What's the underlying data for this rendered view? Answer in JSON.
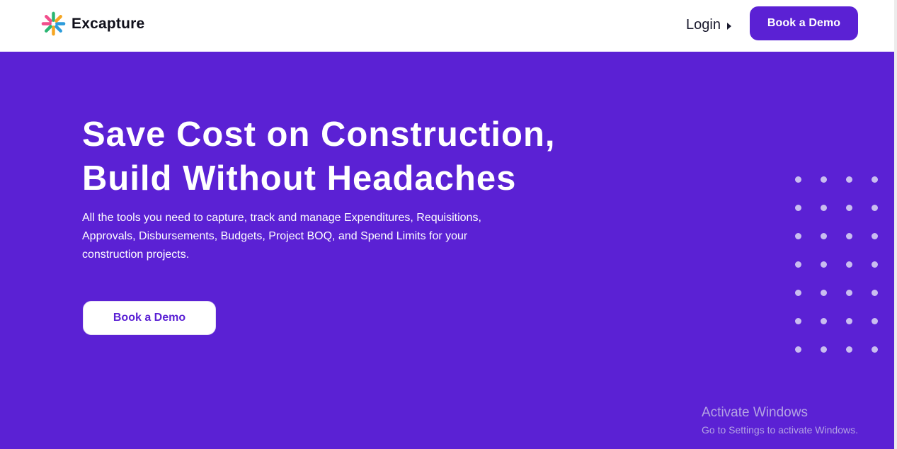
{
  "brand": {
    "name": "Excapture",
    "logo_colors": [
      "#f24e8c",
      "#f6a623",
      "#2bb673",
      "#2d9cdb"
    ]
  },
  "nav": {
    "login_label": "Login",
    "cta_label": "Book a Demo"
  },
  "hero": {
    "headline_line1": "Save Cost on Construction,",
    "headline_line2": "Build Without Headaches",
    "subtext": "All the tools you need to capture, track and manage Expenditures, Requisitions, Approvals, Disbursements, Budgets, Project BOQ, and Spend Limits for your construction projects.",
    "cta_label": "Book a Demo"
  },
  "decoration": {
    "dot_rows": 7,
    "dot_cols": 4
  },
  "os_watermark": {
    "title": "Activate Windows",
    "subtitle": "Go to Settings to activate Windows."
  },
  "colors": {
    "accent": "#5b21d4",
    "text_dark": "#0f0f1a",
    "white": "#ffffff"
  }
}
